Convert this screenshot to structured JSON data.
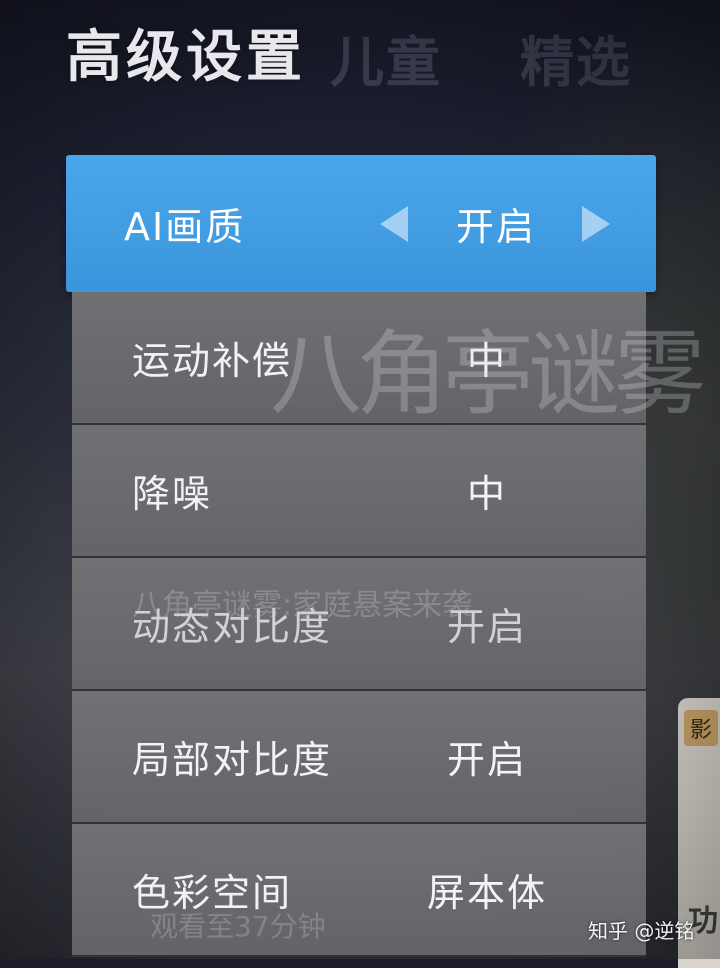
{
  "panel_title": "高级设置",
  "background": {
    "tabs": [
      "儿童",
      "精选"
    ],
    "side_card": {
      "badge": "影",
      "text": "功"
    },
    "ghost_logo": "八角亭谜雾",
    "ghost_subtitle": "八角亭谜雾:家庭悬案来袭",
    "ghost_bottom": "观看至37分钟"
  },
  "menu": {
    "items": [
      {
        "label": "AI画质",
        "value": "开启",
        "selected": true
      },
      {
        "label": "运动补偿",
        "value": "中"
      },
      {
        "label": "降噪",
        "value": "中"
      },
      {
        "label": "动态对比度",
        "value": "开启"
      },
      {
        "label": "局部对比度",
        "value": "开启"
      },
      {
        "label": "色彩空间",
        "value": "屏本体"
      }
    ]
  },
  "colors": {
    "accent": "#3f9be0",
    "row_bg": "#707074",
    "text": "#f2f2f4"
  },
  "icons": {
    "prev": "triangle-left-icon",
    "next": "triangle-right-icon"
  },
  "watermark": "知乎 @逆铭"
}
